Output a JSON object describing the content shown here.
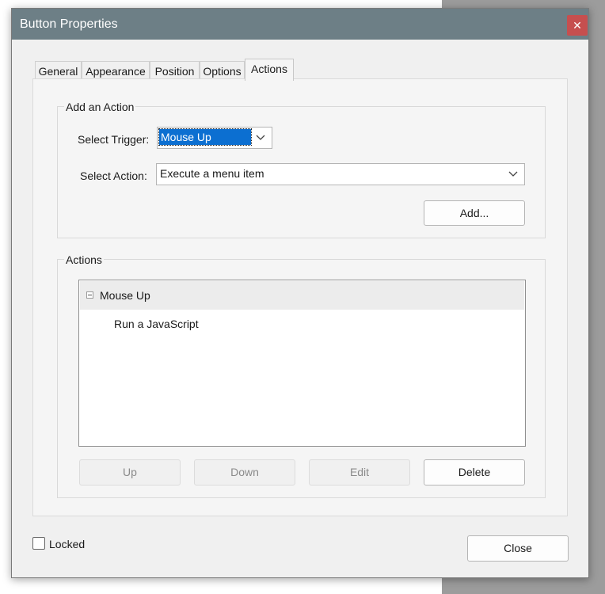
{
  "dialog": {
    "title": "Button Properties",
    "close_glyph": "✕"
  },
  "tabs": [
    {
      "label": "General"
    },
    {
      "label": "Appearance"
    },
    {
      "label": "Position"
    },
    {
      "label": "Options"
    },
    {
      "label": "Actions",
      "active": true
    }
  ],
  "add_action": {
    "legend": "Add an Action",
    "trigger_label": "Select Trigger:",
    "trigger_value": "Mouse Up",
    "action_label": "Select Action:",
    "action_value": "Execute a menu item",
    "add_button": "Add..."
  },
  "actions": {
    "legend": "Actions",
    "tree": {
      "trigger": "Mouse Up",
      "items": [
        "Run a JavaScript"
      ]
    },
    "buttons": {
      "up": "Up",
      "down": "Down",
      "edit": "Edit",
      "delete": "Delete"
    }
  },
  "footer": {
    "locked_label": "Locked",
    "locked_checked": false,
    "close_button": "Close"
  },
  "colors": {
    "titlebar": "#6d7f86",
    "close_button": "#c64f4f",
    "selection": "#0c6fd1"
  },
  "icons": {
    "dropdown": "chevron-down-icon",
    "collapse": "tree-collapse-icon"
  }
}
